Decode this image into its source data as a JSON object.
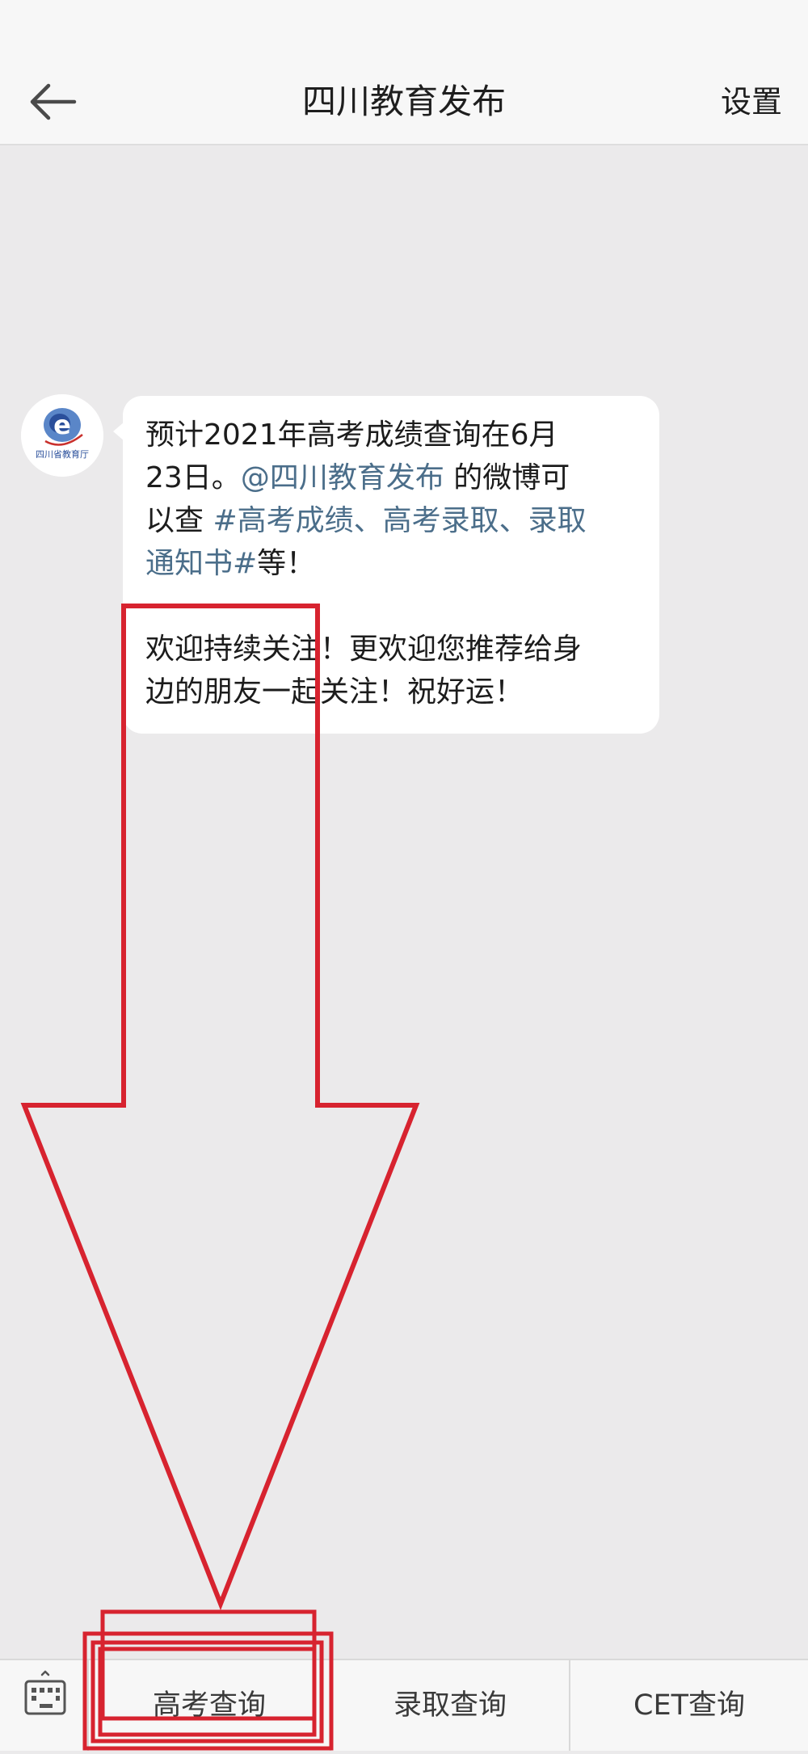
{
  "header": {
    "title": "四川教育发布",
    "settings_label": "设置"
  },
  "message": {
    "avatar_text": "四川省教育厅",
    "line1": "预计2021年高考成绩查询在6月",
    "line2_prefix": "23日。",
    "mention": "@四川教育发布",
    "line2_suffix": " 的微博可",
    "line3_prefix": "以查 ",
    "hashtag_part1": "#高考成绩、高考录取、录取",
    "hashtag_part2": "通知书#",
    "line4_suffix": "等！",
    "para2_line1": "欢迎持续关注！更欢迎您推荐给身",
    "para2_line2": "边的朋友一起关注！祝好运！"
  },
  "bottom_menu": {
    "items": [
      {
        "label": "高考查询"
      },
      {
        "label": "录取查询"
      },
      {
        "label": "CET查询"
      }
    ]
  },
  "colors": {
    "link": "#4b6e8a",
    "annotation": "#d7232f",
    "background": "#ebeaeb"
  }
}
